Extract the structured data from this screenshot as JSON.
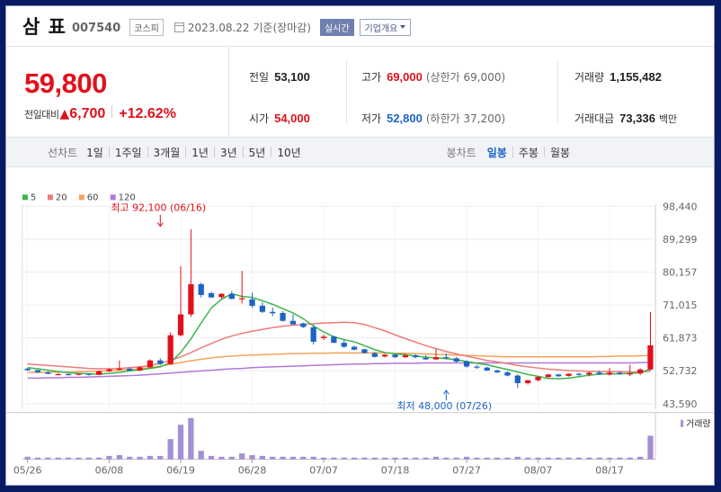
{
  "header": {
    "name": "삼 표",
    "code": "007540",
    "market": "코스피",
    "date": "2023.08.22 기준(장마감)",
    "realtime": "실시간",
    "overview": "기업개요"
  },
  "price": {
    "current": "59,800",
    "change_label": "전일대비",
    "change_arrow": "▲",
    "change_value": "6,700",
    "change_pct": "+12.62%"
  },
  "stats": {
    "prev_close_label": "전일",
    "prev_close": "53,100",
    "high_label": "고가",
    "high": "69,000",
    "upper_limit": "(상한가 69,000)",
    "volume_label": "거래량",
    "volume": "1,155,482",
    "open_label": "시가",
    "open": "54,000",
    "low_label": "저가",
    "low": "52,800",
    "lower_limit": "(하한가 37,200)",
    "trade_value_label": "거래대금",
    "trade_value": "73,336",
    "trade_value_unit": "백만"
  },
  "tabs": {
    "line_title": "선차트",
    "line_items": [
      "1일",
      "1주일",
      "3개월",
      "1년",
      "3년",
      "5년",
      "10년"
    ],
    "candle_title": "봉차트",
    "candle_items": [
      "일봉",
      "주봉",
      "월봉"
    ],
    "active": "일봉"
  },
  "colors": {
    "up": "#e0111b",
    "down": "#1c63c7",
    "ma5": "#3ab54a",
    "ma20": "#f07a7a",
    "ma60": "#f5a35b",
    "ma120": "#b07ad8"
  },
  "chart_data": {
    "type": "candlestick",
    "legend": [
      {
        "name": "5",
        "color": "#3ab54a"
      },
      {
        "name": "20",
        "color": "#f07a7a"
      },
      {
        "name": "60",
        "color": "#f5a35b"
      },
      {
        "name": "120",
        "color": "#b07ad8"
      }
    ],
    "y_ticks": [
      "98,440",
      "89,299",
      "80,157",
      "71,015",
      "61,873",
      "52,732",
      "43,590"
    ],
    "y_tick_values": [
      98440,
      89299,
      80157,
      71015,
      61873,
      52732,
      43590
    ],
    "ylim": [
      43590,
      98440
    ],
    "x_ticks": [
      "05/26",
      "06/08",
      "06/19",
      "06/28",
      "07/07",
      "07/18",
      "07/27",
      "08/07",
      "08/17"
    ],
    "x_tick_index": [
      0,
      8,
      15,
      22,
      29,
      36,
      43,
      50,
      57
    ],
    "high_annotation": {
      "text": "최고 92,100 (06/16)",
      "index": 13,
      "value": 92100
    },
    "low_annotation": {
      "text": "최저 48,000 (07/26)",
      "index": 41,
      "value": 48000
    },
    "volume_label": "거래량",
    "candles": [
      [
        53300,
        53500,
        52700,
        52900
      ],
      [
        52900,
        53000,
        52200,
        52300
      ],
      [
        52300,
        52600,
        51700,
        51900
      ],
      [
        51800,
        52100,
        51500,
        51800
      ],
      [
        51800,
        52000,
        51400,
        51600
      ],
      [
        51600,
        52100,
        51400,
        51900
      ],
      [
        51900,
        52000,
        51400,
        51600
      ],
      [
        51600,
        52800,
        51500,
        52600
      ],
      [
        52600,
        53400,
        52400,
        53100
      ],
      [
        53100,
        55600,
        52800,
        53300
      ],
      [
        53300,
        53700,
        52700,
        52800
      ],
      [
        52800,
        53900,
        52600,
        53700
      ],
      [
        53700,
        55900,
        53500,
        55600
      ],
      [
        55600,
        56200,
        54300,
        54600
      ],
      [
        54600,
        63400,
        54500,
        62600
      ],
      [
        62600,
        81800,
        62300,
        68400
      ],
      [
        68400,
        92100,
        67700,
        76800
      ],
      [
        76800,
        77200,
        73100,
        73800
      ],
      [
        74300,
        74700,
        73000,
        73100
      ],
      [
        73200,
        74300,
        72700,
        74100
      ],
      [
        74100,
        74900,
        72600,
        72700
      ],
      [
        72600,
        80500,
        71400,
        72900
      ],
      [
        72600,
        74400,
        70200,
        70800
      ],
      [
        70800,
        71800,
        68800,
        69100
      ],
      [
        69100,
        70300,
        67900,
        68700
      ],
      [
        68800,
        69300,
        66400,
        66600
      ],
      [
        66600,
        68400,
        65800,
        65600
      ],
      [
        65900,
        66100,
        64600,
        64900
      ],
      [
        64800,
        65400,
        60000,
        60800
      ],
      [
        61800,
        62800,
        61200,
        62200
      ],
      [
        62200,
        62500,
        60400,
        60500
      ],
      [
        60500,
        61400,
        59100,
        59400
      ],
      [
        59400,
        59700,
        58400,
        58600
      ],
      [
        58700,
        58800,
        57500,
        57700
      ],
      [
        57600,
        58000,
        56400,
        56600
      ],
      [
        56700,
        57400,
        56400,
        57200
      ],
      [
        57200,
        57300,
        56300,
        56500
      ],
      [
        56500,
        57400,
        56300,
        57000
      ],
      [
        57000,
        57300,
        56200,
        56500
      ],
      [
        56300,
        57100,
        55700,
        55900
      ],
      [
        55900,
        58800,
        55700,
        56500
      ],
      [
        56500,
        57600,
        55900,
        56300
      ],
      [
        56200,
        56600,
        55000,
        55300
      ],
      [
        55300,
        55600,
        53600,
        53900
      ],
      [
        53900,
        54300,
        53200,
        53600
      ],
      [
        53600,
        53900,
        52700,
        52800
      ],
      [
        52800,
        53100,
        52100,
        52300
      ],
      [
        52300,
        52600,
        51200,
        51400
      ],
      [
        51400,
        51700,
        48000,
        49300
      ],
      [
        49300,
        50200,
        48900,
        50100
      ],
      [
        50100,
        51200,
        49800,
        51000
      ],
      [
        51000,
        51900,
        50700,
        51700
      ],
      [
        51700,
        51900,
        51000,
        51200
      ],
      [
        51300,
        52000,
        51100,
        51900
      ],
      [
        51900,
        52200,
        51300,
        51800
      ],
      [
        51700,
        52500,
        51200,
        52200
      ],
      [
        52200,
        52800,
        51600,
        51700
      ],
      [
        51700,
        53500,
        51400,
        52200
      ],
      [
        52200,
        52500,
        51600,
        51800
      ],
      [
        51800,
        54400,
        51300,
        52000
      ],
      [
        52000,
        53400,
        51500,
        53100
      ],
      [
        53100,
        69000,
        52800,
        59800
      ]
    ],
    "ma5": [
      53600,
      53300,
      52900,
      52500,
      52200,
      52000,
      51900,
      51800,
      52000,
      52300,
      52700,
      53000,
      53400,
      53800,
      55000,
      57800,
      61600,
      66000,
      70200,
      72600,
      74100,
      73400,
      73100,
      72200,
      71200,
      70000,
      68800,
      67200,
      65200,
      63500,
      62200,
      61400,
      60800,
      59700,
      58600,
      57800,
      57400,
      57200,
      56800,
      56500,
      56300,
      56100,
      55800,
      55300,
      54800,
      54400,
      53700,
      53100,
      52400,
      51700,
      51200,
      50600,
      50500,
      50700,
      51100,
      51500,
      51800,
      51900,
      51900,
      52000,
      52200,
      53200
    ],
    "ma20": [
      54600,
      54400,
      54200,
      54000,
      53800,
      53600,
      53400,
      53300,
      53300,
      53400,
      53600,
      53800,
      54200,
      54800,
      55600,
      56600,
      57800,
      59100,
      60300,
      61500,
      62400,
      63100,
      63700,
      64200,
      64700,
      65100,
      65400,
      65600,
      65800,
      66000,
      66100,
      66200,
      66100,
      65600,
      64700,
      63800,
      62700,
      61700,
      60700,
      59700,
      58900,
      58100,
      57400,
      56800,
      56200,
      55600,
      55200,
      54700,
      54200,
      53800,
      53500,
      53200,
      53000,
      52800,
      52700,
      52600,
      52500,
      52500,
      52500,
      52400,
      52400,
      52600
    ],
    "ma60": [
      52300,
      52300,
      52300,
      52400,
      52400,
      52500,
      52500,
      52600,
      52700,
      52900,
      53100,
      53300,
      53600,
      54000,
      54500,
      55000,
      55500,
      55900,
      56300,
      56600,
      56800,
      57000,
      57100,
      57200,
      57300,
      57400,
      57500,
      57500,
      57600,
      57600,
      57700,
      57700,
      57700,
      57700,
      57700,
      57700,
      57600,
      57600,
      57500,
      57400,
      57300,
      57200,
      57100,
      57000,
      56900,
      56800,
      56700,
      56600,
      56600,
      56600,
      56600,
      56600,
      56600,
      56600,
      56600,
      56600,
      56700,
      56700,
      56800,
      56800,
      56900,
      57000
    ],
    "ma120": [
      50700,
      50700,
      50800,
      50800,
      50900,
      50900,
      51000,
      51100,
      51200,
      51300,
      51400,
      51500,
      51700,
      51900,
      52100,
      52300,
      52500,
      52700,
      52900,
      53100,
      53300,
      53400,
      53600,
      53700,
      53800,
      53900,
      54000,
      54100,
      54200,
      54300,
      54400,
      54500,
      54600,
      54600,
      54700,
      54700,
      54800,
      54800,
      54800,
      54900,
      54900,
      54900,
      54900,
      54900,
      54900,
      54900,
      54900,
      54900,
      54900,
      54900,
      54900,
      54900,
      54900,
      54900,
      54900,
      54900,
      54900,
      54900,
      54900,
      54900,
      55000,
      55000
    ],
    "volume": [
      3,
      2,
      2,
      2,
      2,
      2,
      2,
      2,
      4,
      5,
      3,
      3,
      4,
      4,
      24,
      41,
      49,
      10,
      4,
      3,
      3,
      7,
      5,
      4,
      3,
      3,
      3,
      3,
      3,
      2,
      2,
      2,
      2,
      2,
      2,
      2,
      2,
      2,
      2,
      2,
      3,
      2,
      2,
      3,
      2,
      2,
      2,
      2,
      3,
      2,
      2,
      2,
      2,
      2,
      2,
      2,
      2,
      2,
      2,
      2,
      3,
      28
    ]
  }
}
